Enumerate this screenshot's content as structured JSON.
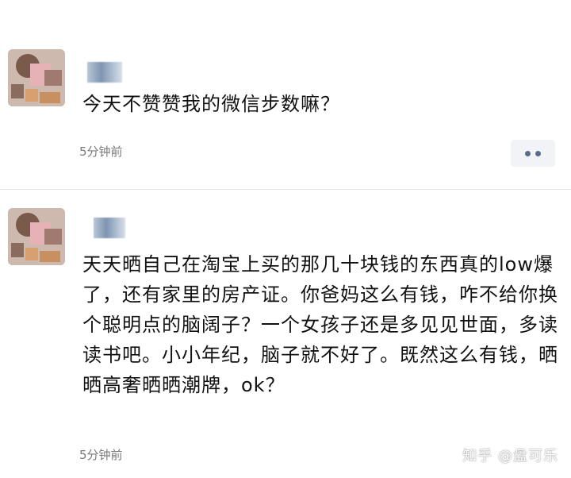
{
  "posts": [
    {
      "content": "今天不赞赞我的微信步数嘛？",
      "time": "5分钟前"
    },
    {
      "content": "天天晒自己在淘宝上买的那几十块钱的东西真的low爆了，还有家里的房产证。你爸妈这么有钱，咋不给你换个聪明点的脑阔子？一个女孩子还是多见见世面，多读读书吧。小小年纪，脑子就不好了。既然这么有钱，晒晒高奢晒晒潮牌，ok？",
      "time": "5分钟前"
    }
  ],
  "watermark": "知乎 @盘可乐",
  "icons": {
    "more": "more-dots-icon"
  }
}
